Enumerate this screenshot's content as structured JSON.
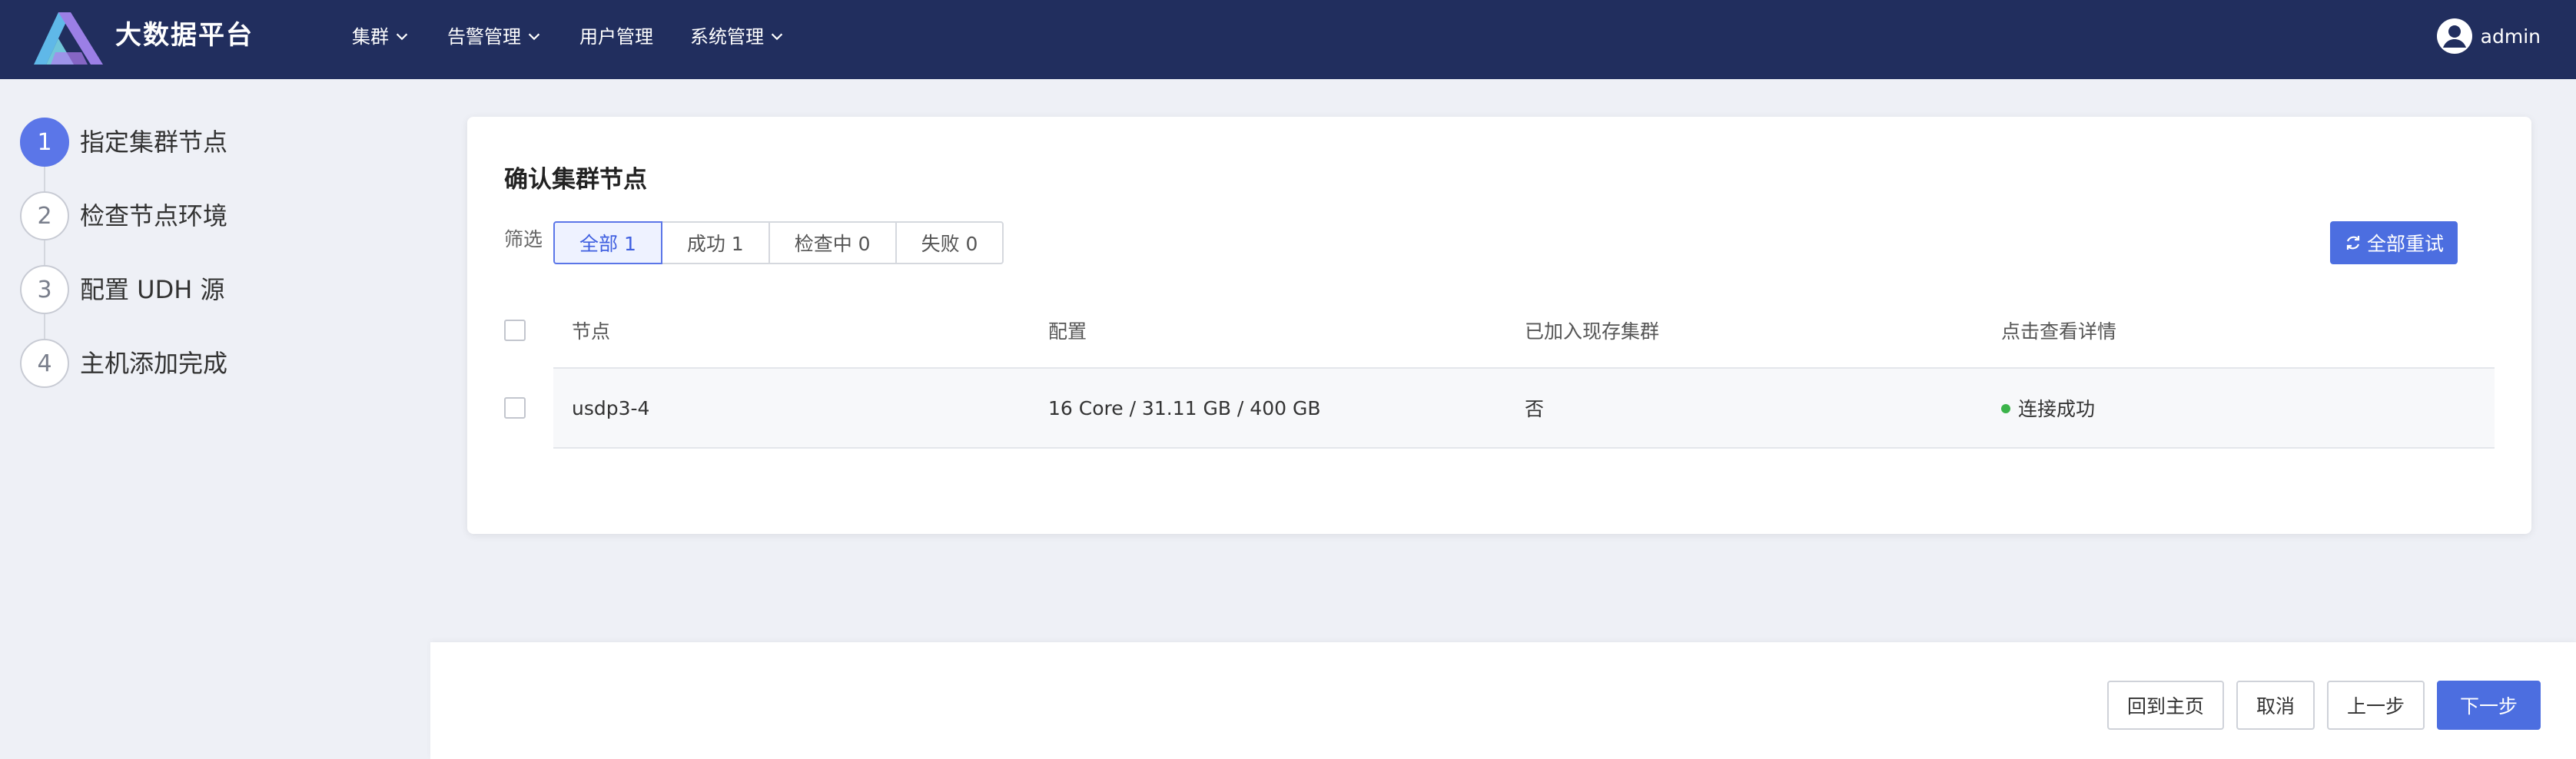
{
  "app": {
    "title": "大数据平台"
  },
  "nav": {
    "items": [
      {
        "label": "集群",
        "has_dropdown": true
      },
      {
        "label": "告警管理",
        "has_dropdown": true
      },
      {
        "label": "用户管理",
        "has_dropdown": false
      },
      {
        "label": "系统管理",
        "has_dropdown": true
      }
    ]
  },
  "user": {
    "name": "admin",
    "icon": "user-avatar-icon"
  },
  "steps": [
    {
      "number": "1",
      "label": "指定集群节点",
      "active": true
    },
    {
      "number": "2",
      "label": "检查节点环境",
      "active": false
    },
    {
      "number": "3",
      "label": "配置 UDH 源",
      "active": false
    },
    {
      "number": "4",
      "label": "主机添加完成",
      "active": false
    }
  ],
  "card": {
    "title": "确认集群节点",
    "filter_label": "筛选",
    "filters": [
      {
        "label": "全部 1",
        "active": true
      },
      {
        "label": "成功 1",
        "active": false
      },
      {
        "label": "检查中 0",
        "active": false
      },
      {
        "label": "失败 0",
        "active": false
      }
    ],
    "retry_all_label": "全部重试"
  },
  "table": {
    "headers": [
      "节点",
      "配置",
      "已加入现存集群",
      "点击查看详情"
    ],
    "rows": [
      {
        "node": "usdp3-4",
        "config": "16 Core / 31.11 GB / 400 GB",
        "joined": "否",
        "status": "连接成功"
      }
    ]
  },
  "footer": {
    "home_label": "回到主页",
    "cancel_label": "取消",
    "prev_label": "上一步",
    "next_label": "下一步"
  },
  "colors": {
    "topbar": "#212e5e",
    "accent": "#4c6ee0",
    "step_active": "#5b76e8",
    "success": "#3bb34a"
  }
}
